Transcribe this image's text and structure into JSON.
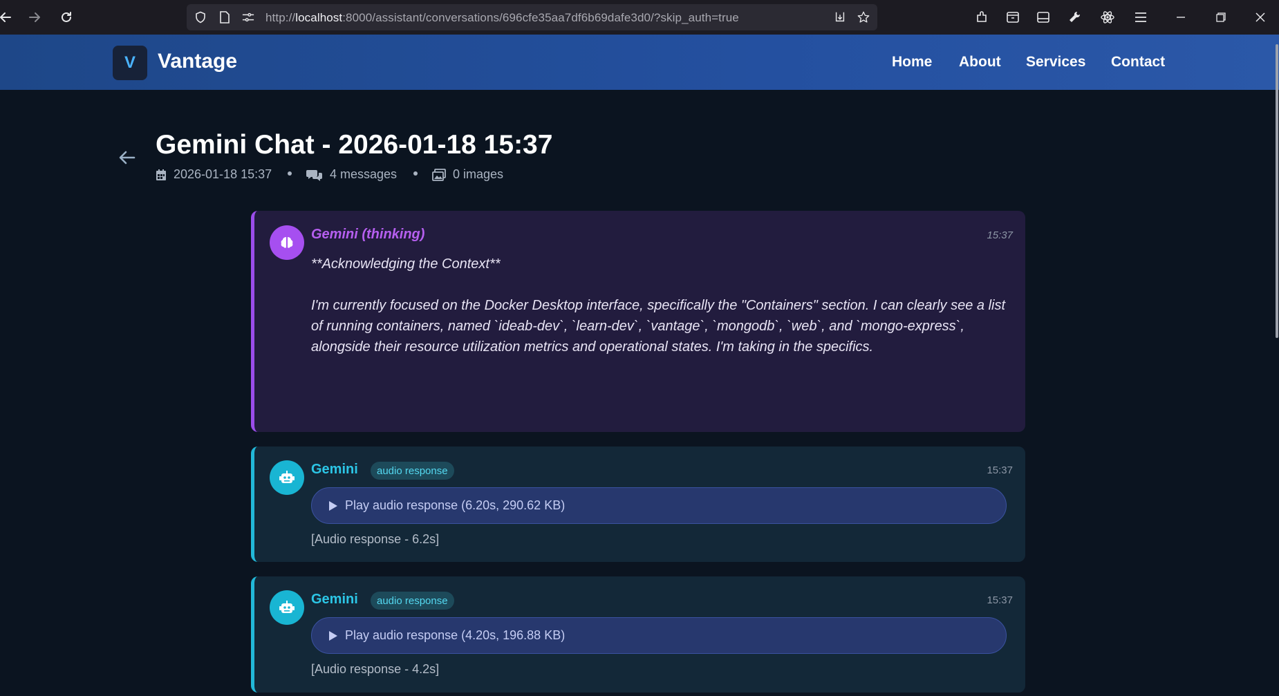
{
  "browser": {
    "url_prefix": "http://",
    "url_host": "localhost",
    "url_rest": ":8000/assistant/conversations/696cfe35aa7df6b69dafe3d0/?skip_auth=true"
  },
  "site": {
    "logo_letter": "V",
    "brand": "Vantage",
    "nav": [
      "Home",
      "About",
      "Services",
      "Contact"
    ]
  },
  "page": {
    "title": "Gemini Chat - 2026-01-18 15:37",
    "meta_date": "2026-01-18 15:37",
    "meta_messages": "4 messages",
    "meta_images": "0 images"
  },
  "messages": [
    {
      "sender": "Gemini (thinking)",
      "time": "15:37",
      "heading": "**Acknowledging the Context**",
      "body": "I'm currently focused on the Docker Desktop interface, specifically the \"Containers\" section. I can clearly see a list of running containers, named `ideab-dev`, `learn-dev`, `vantage`, `mongodb`, `web`, and `mongo-express`, alongside their resource utilization metrics and operational states. I'm taking in the specifics."
    },
    {
      "sender": "Gemini",
      "badge": "audio response",
      "time": "15:37",
      "play_label": "Play audio response (6.20s, 290.62 KB)",
      "note": "[Audio response - 6.2s]"
    },
    {
      "sender": "Gemini",
      "badge": "audio response",
      "time": "15:37",
      "play_label": "Play audio response (4.20s, 196.88 KB)",
      "note": "[Audio response - 4.2s]"
    }
  ],
  "colors": {
    "header_bg": "#2450a0",
    "thinking_accent": "#9b4dea",
    "response_accent": "#22b8d8",
    "page_bg": "#0b1420"
  }
}
